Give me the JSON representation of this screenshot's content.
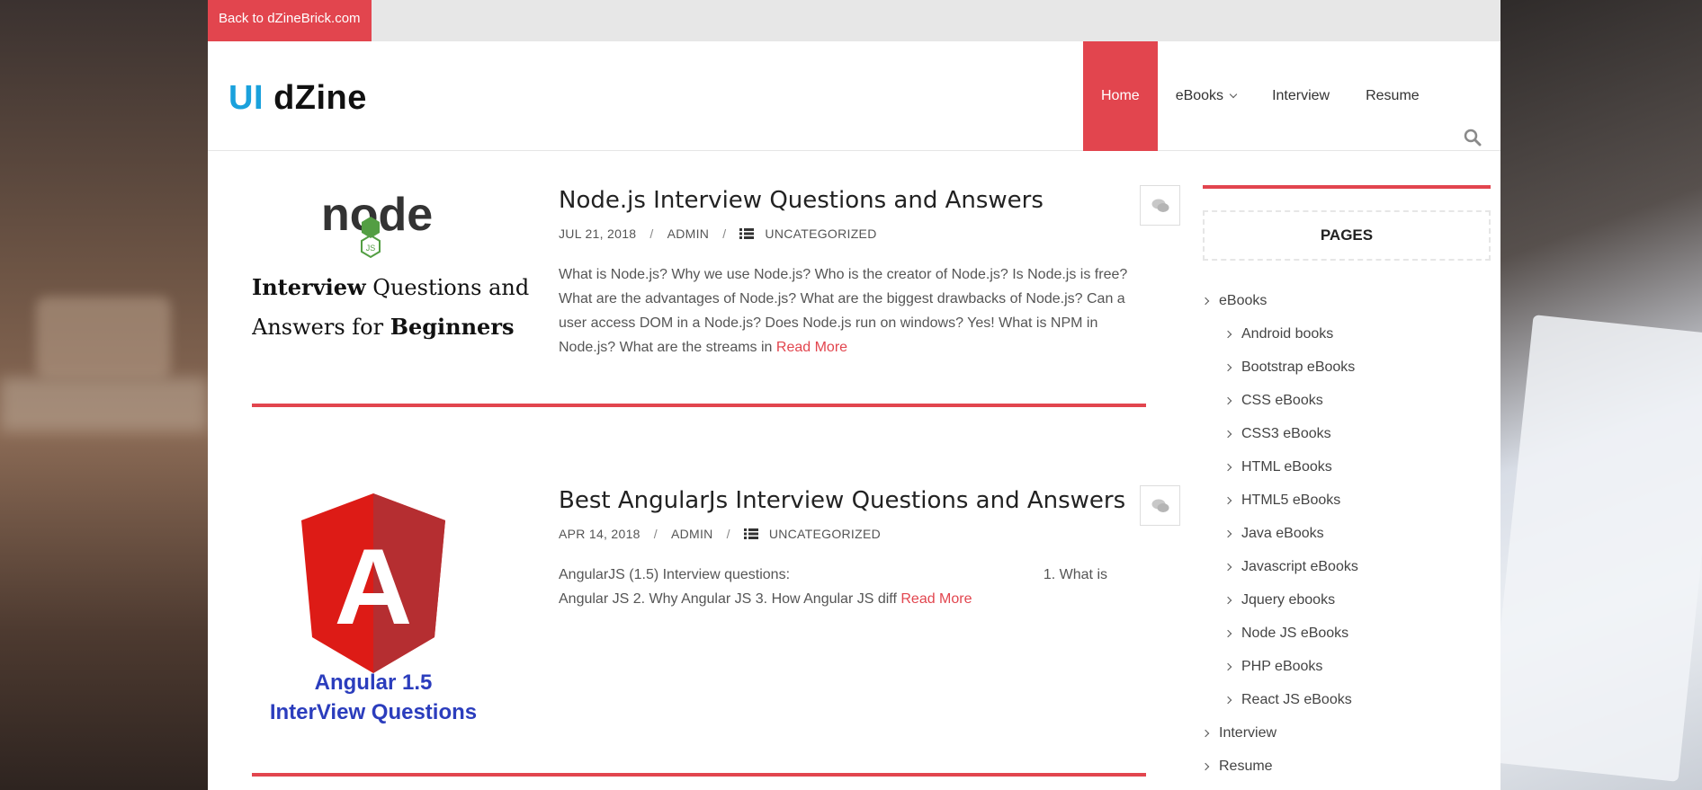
{
  "topbar": {
    "back_label": "Back to dZineBrick.com"
  },
  "logo": {
    "part1": "UI",
    "part2": "dZine"
  },
  "nav": {
    "items": [
      {
        "label": "Home",
        "active": true
      },
      {
        "label": "eBooks",
        "dropdown": true
      },
      {
        "label": "Interview"
      },
      {
        "label": "Resume"
      }
    ],
    "search_icon": "search-icon"
  },
  "posts": [
    {
      "title": "Node.js Interview Questions and Answers",
      "date": "JUL 21, 2018",
      "author": "ADMIN",
      "category": "UNCATEGORIZED",
      "excerpt": "  What is Node.js? Why we use Node.js? Who is the creator of Node.js? Is Node.js is free? What are the advantages of Node.js? What are the biggest drawbacks of Node.js? Can a user access DOM in a Node.js? Does Node.js run on windows? Yes! What is NPM in Node.js? What are the streams in",
      "read_more": "Read More",
      "thumb": {
        "logo_text": "node",
        "badge": "JS",
        "line1a": "Interview",
        "line1b": " Questions and",
        "line2a": "Answers for ",
        "line2b": "Beginners"
      }
    },
    {
      "title": "Best AngularJs Interview Questions and Answers",
      "date": "APR 14, 2018",
      "author": "ADMIN",
      "category": "UNCATEGORIZED",
      "excerpt_line1": "AngularJS (1.5) Interview questions:",
      "excerpt_line1b": "1. What is",
      "excerpt_line2": "Angular JS 2. Why Angular JS 3. How Angular JS diff",
      "read_more": "Read More",
      "thumb": {
        "letter": "A",
        "line1": "Angular 1.5",
        "line2": "InterView Questions"
      }
    }
  ],
  "sidebar": {
    "heading": "PAGES",
    "tree": [
      {
        "label": "eBooks",
        "level": 0
      },
      {
        "label": "Android books",
        "level": 1
      },
      {
        "label": "Bootstrap eBooks",
        "level": 1
      },
      {
        "label": "CSS eBooks",
        "level": 1
      },
      {
        "label": "CSS3 eBooks",
        "level": 1
      },
      {
        "label": "HTML eBooks",
        "level": 1
      },
      {
        "label": "HTML5 eBooks",
        "level": 1
      },
      {
        "label": "Java eBooks",
        "level": 1
      },
      {
        "label": "Javascript eBooks",
        "level": 1
      },
      {
        "label": "Jquery ebooks",
        "level": 1
      },
      {
        "label": "Node JS eBooks",
        "level": 1
      },
      {
        "label": "PHP eBooks",
        "level": 1
      },
      {
        "label": "React JS eBooks",
        "level": 1
      },
      {
        "label": "Interview",
        "level": 0
      },
      {
        "label": "Resume",
        "level": 0
      }
    ]
  },
  "colors": {
    "accent": "#e2454e",
    "logo_blue": "#1aa1dc",
    "node_green": "#539e43",
    "angular_red": "#dd1b16",
    "angular_text": "#2b3dbd"
  }
}
